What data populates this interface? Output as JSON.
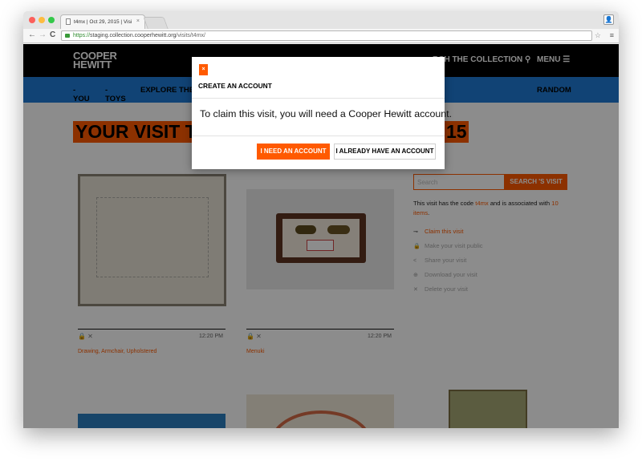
{
  "browser": {
    "tab_title": "t4mx | Oct 29, 2015 | Visi",
    "url_scheme": "https://",
    "url_host": "staging.collection.cooperhewitt.org",
    "url_path": "/visits/t4mx/",
    "close_glyph": "×",
    "profile_glyph": "👤",
    "star_glyph": "☆",
    "menu_glyph": "≡",
    "back_glyph": "←",
    "forward_glyph": "→",
    "reload_glyph": "C"
  },
  "site": {
    "logo_line1": "COOPER",
    "logo_line2": "HEWITT",
    "search_label": "RCH THE COLLECTION",
    "search_icon": "magnifier-icon",
    "search_glyph": "⚲",
    "menu_label": "MENU",
    "menu_glyph": "☰",
    "nav": [
      {
        "label": "YOU"
      },
      {
        "label": "TOYS"
      },
      {
        "label": "EXPLORE THE C"
      }
    ],
    "random_label": "RANDOM"
  },
  "visit": {
    "title_start": "YOUR VISIT TO T",
    "title_end": "15",
    "search_placeholder": "Search",
    "search_button": "SEARCH 'S VISIT",
    "desc_pre": "This visit has the code ",
    "code": "t4mx",
    "desc_mid": " and is associated with ",
    "items": "10 items",
    "desc_post": ".",
    "actions": [
      {
        "icon": "key-icon",
        "glyph": "⊸",
        "label": "Claim this visit"
      },
      {
        "icon": "lock-icon",
        "glyph": "🔒",
        "label": "Make your visit public"
      },
      {
        "icon": "share-icon",
        "glyph": "<",
        "label": "Share your visit"
      },
      {
        "icon": "download-icon",
        "glyph": "⊕",
        "label": "Download your visit"
      },
      {
        "icon": "delete-icon",
        "glyph": "✕",
        "label": "Delete your visit"
      }
    ]
  },
  "objects": [
    {
      "title": "Drawing, Armchair, Upholstered",
      "time": "12:20 PM",
      "icons": "🔒 ✕"
    },
    {
      "title": "Menuki",
      "time": "12:20 PM",
      "icons": "🔒 ✕"
    }
  ],
  "modal": {
    "close_glyph": "×",
    "title": "CREATE AN ACCOUNT",
    "message": "To claim this visit, you will need a Cooper Hewitt account.",
    "primary_button": "I NEED AN ACCOUNT",
    "secondary_button": "I ALREADY HAVE AN ACCOUNT"
  },
  "colors": {
    "accent": "#ff5a00",
    "nav_blue": "#1f7bd6",
    "header_black": "#000000"
  }
}
